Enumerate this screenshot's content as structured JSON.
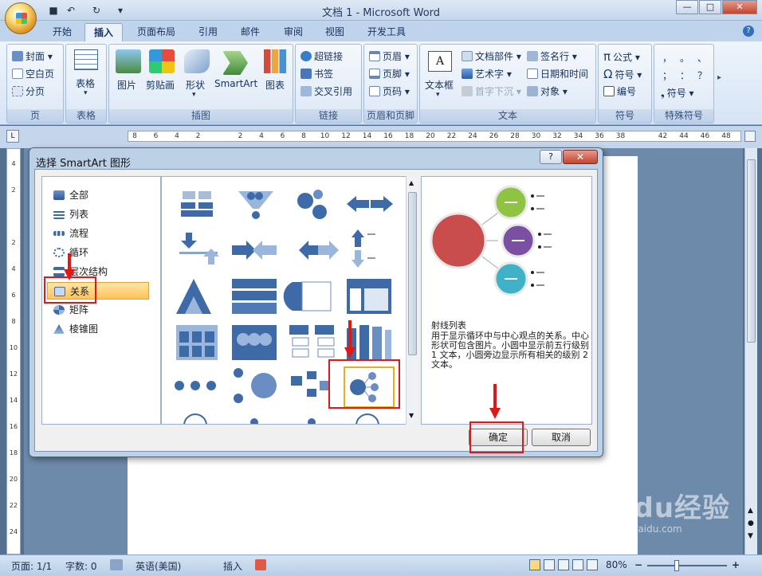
{
  "window": {
    "title": "文档 1 - Microsoft Word"
  },
  "quick_access": {
    "save_icon": "save-icon",
    "undo": "↶",
    "redo": "↻",
    "more": "▾"
  },
  "win_controls": {
    "minimize": "—",
    "maximize": "□",
    "close": "✕"
  },
  "tabs": [
    "开始",
    "插入",
    "页面布局",
    "引用",
    "邮件",
    "审阅",
    "视图",
    "开发工具"
  ],
  "active_tab": "插入",
  "help_icon": "?",
  "ribbon": {
    "page_group": {
      "label": "页",
      "items": [
        "封面",
        "空白页",
        "分页"
      ]
    },
    "table_group": {
      "label": "表格",
      "button": "表格"
    },
    "illustration_group": {
      "label": "插图",
      "buttons": [
        "图片",
        "剪贴画",
        "形状",
        "SmartArt",
        "图表"
      ]
    },
    "link_group": {
      "label": "链接",
      "items": [
        "超链接",
        "书签",
        "交叉引用"
      ]
    },
    "header_footer_group": {
      "label": "页眉和页脚",
      "items": [
        "页眉",
        "页脚",
        "页码"
      ]
    },
    "text_group": {
      "label": "文本",
      "textbox": "文本框",
      "items": [
        "文档部件",
        "艺术字",
        "首字下沉",
        "签名行",
        "日期和时间",
        "对象"
      ]
    },
    "symbol_group": {
      "label": "符号",
      "items": [
        "公式",
        "符号",
        "编号"
      ]
    },
    "special_group": {
      "label": "特殊符号",
      "chars": [
        "，",
        "。",
        "、",
        "；",
        "：",
        "？"
      ],
      "more": "符号"
    }
  },
  "ruler": {
    "ticks": [
      "8",
      "6",
      "4",
      "2",
      "",
      "2",
      "4",
      "6",
      "8",
      "10",
      "12",
      "14",
      "16",
      "18",
      "20",
      "22",
      "24",
      "26",
      "28",
      "30",
      "32",
      "34",
      "36",
      "38",
      "",
      "42",
      "44",
      "46",
      "48"
    ]
  },
  "vruler": {
    "ticks": [
      "4",
      "2",
      "",
      "2",
      "4",
      "6",
      "8",
      "10",
      "12",
      "14",
      "16",
      "18",
      "20",
      "22",
      "24"
    ]
  },
  "dialog": {
    "title": "选择 SmartArt 图形",
    "help": "?",
    "close": "✕",
    "categories": [
      "全部",
      "列表",
      "流程",
      "循环",
      "层次结构",
      "关系",
      "矩阵",
      "棱锥图"
    ],
    "selected_category": "关系",
    "preview_name": "射线列表",
    "preview_desc": "用于显示循环中与中心观点的关系。中心形状可包含图片。小圆中显示前五行级别 1 文本，小圆旁边显示所有相关的级别 2 文本。",
    "ok": "确定",
    "cancel": "取消"
  },
  "status": {
    "page": "页面: 1/1",
    "words": "字数: 0",
    "language": "英语(美国)",
    "mode": "插入",
    "zoom": "80%"
  },
  "watermark": {
    "main": "Baidu经验",
    "sub": "jingyan.baidu.com"
  },
  "colors": {
    "highlight": "#e01818",
    "accent_blue": "#3e6aa8",
    "preview_red": "#c94d4d",
    "preview_green": "#8fc344",
    "preview_purple": "#7b4fa2",
    "preview_cyan": "#3fb1c9"
  }
}
